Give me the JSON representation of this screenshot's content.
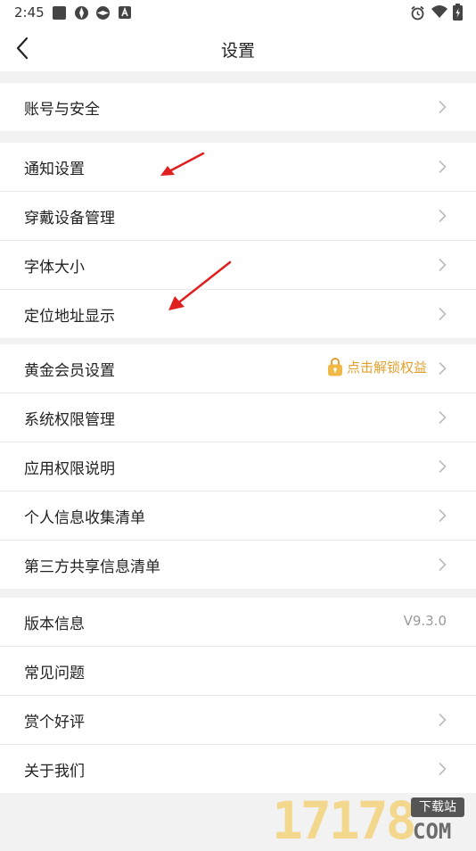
{
  "status_bar": {
    "time": "2:45",
    "icons": [
      "gallery-icon",
      "app-icon",
      "app-icon",
      "notification-a-icon",
      "alarm-icon",
      "wifi-icon",
      "battery-icon"
    ]
  },
  "header": {
    "title": "设置"
  },
  "groups": [
    {
      "items": [
        {
          "label": "账号与安全"
        }
      ]
    },
    {
      "items": [
        {
          "label": "通知设置"
        },
        {
          "label": "穿戴设备管理"
        },
        {
          "label": "字体大小"
        },
        {
          "label": "定位地址显示"
        }
      ]
    },
    {
      "items": [
        {
          "label": "黄金会员设置",
          "badge": "点击解锁权益"
        },
        {
          "label": "系统权限管理"
        },
        {
          "label": "应用权限说明"
        },
        {
          "label": "个人信息收集清单"
        },
        {
          "label": "第三方共享信息清单"
        }
      ]
    },
    {
      "items": [
        {
          "label": "版本信息",
          "value": "V9.3.0"
        },
        {
          "label": "常见问题"
        },
        {
          "label": "赏个好评"
        },
        {
          "label": "关于我们"
        }
      ]
    }
  ],
  "watermark": {
    "number": "17178",
    "tag": "下载站",
    "domain": "COM"
  },
  "colors": {
    "accent_gold": "#e0a02e",
    "arrow_red": "#e02020",
    "background": "#f2f2f2"
  }
}
